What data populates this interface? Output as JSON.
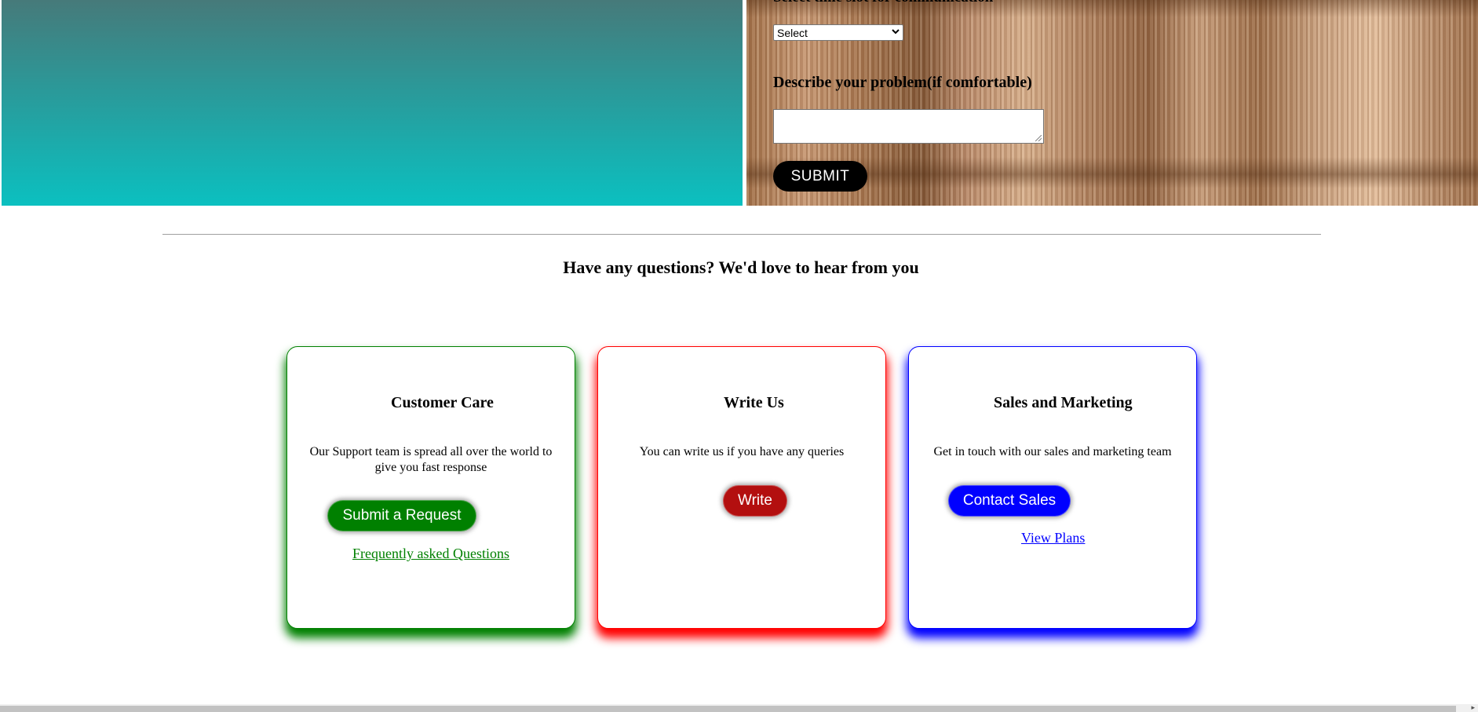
{
  "form": {
    "time_slot_label": "Select time slot for communication",
    "time_slot_selected": "Select",
    "problem_label": "Describe your problem(if comfortable)",
    "problem_value": "",
    "submit_label": "SUBMIT"
  },
  "section": {
    "heading": "Have any questions? We'd love to hear from you"
  },
  "cards": [
    {
      "title": "Customer Care",
      "text": "Our Support team is spread all over the world to give you fast response",
      "button_label": "Submit a Request",
      "link_label": "Frequently asked Questions",
      "accent": "#008000"
    },
    {
      "title": "Write Us",
      "text": "You can write us if you have any queries",
      "button_label": "Write",
      "accent": "#ff0000",
      "button_color": "#b30f0f"
    },
    {
      "title": "Sales and Marketing",
      "text": "Get in touch with our sales and marketing team",
      "button_label": "Contact Sales",
      "link_label": "View Plans",
      "accent": "#0000ff"
    }
  ],
  "icons": {
    "select_chevron": "chevron-down-icon",
    "textarea_grip": "resize-grip-icon",
    "scroll_arrow": "scroll-right-icon"
  }
}
